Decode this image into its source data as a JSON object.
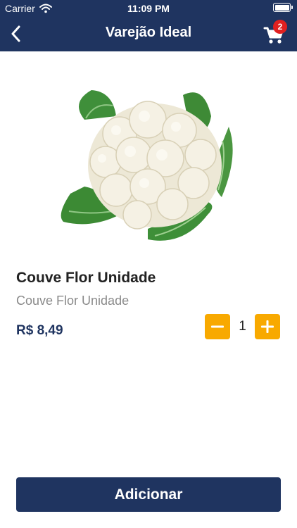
{
  "status_bar": {
    "carrier": "Carrier",
    "time": "11:09 PM"
  },
  "nav": {
    "title": "Varejão Ideal",
    "cart_count": "2"
  },
  "product": {
    "name": "Couve Flor Unidade",
    "description": "Couve Flor Unidade",
    "price": "R$ 8,49",
    "quantity": "1",
    "image": "cauliflower"
  },
  "actions": {
    "add_label": "Adicionar"
  },
  "colors": {
    "primary": "#1f3460",
    "accent": "#f8a900",
    "badge": "#e02020"
  },
  "icons": [
    "wifi-icon",
    "battery-icon",
    "back-chevron-icon",
    "cart-icon",
    "minus-icon",
    "plus-icon"
  ]
}
